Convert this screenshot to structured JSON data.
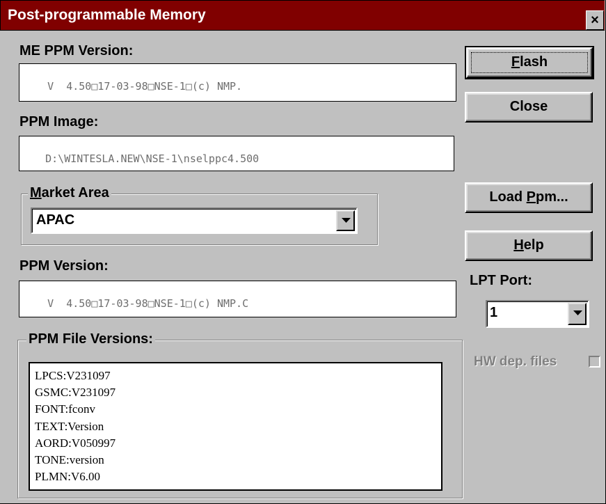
{
  "window": {
    "title": "Post-programmable Memory",
    "close_label": "×"
  },
  "me_ppm_version": {
    "label": "ME PPM Version:",
    "value": "V  4.50□17-03-98□NSE-1□(c) NMP."
  },
  "ppm_image": {
    "label": "PPM Image:",
    "value": "D:\\WINTESLA.NEW\\NSE-1\\nselppc4.500"
  },
  "market_area": {
    "label_prefix": "",
    "label_mnemonic": "M",
    "label_rest": "arket Area",
    "selected": "APAC"
  },
  "ppm_version": {
    "label": "PPM Version:",
    "value": "V  4.50□17-03-98□NSE-1□(c) NMP.C"
  },
  "ppm_file_versions": {
    "label": "PPM File Versions:",
    "items": [
      "LPCS:V231097",
      "GSMC:V231097",
      "FONT:fconv",
      "TEXT:Version",
      "AORD:V050997",
      "TONE:version",
      "PLMN:V6.00"
    ]
  },
  "buttons": {
    "flash": {
      "mnemonic": "F",
      "rest": "lash"
    },
    "close": "Close",
    "load_ppm": {
      "prefix": "Load ",
      "mnemonic": "P",
      "rest": "pm..."
    },
    "help": {
      "mnemonic": "H",
      "rest": "elp"
    }
  },
  "lpt_port": {
    "label": "LPT Port:",
    "selected": "1"
  },
  "hw_dep_files": {
    "label": "HW dep. files",
    "checked": false
  }
}
